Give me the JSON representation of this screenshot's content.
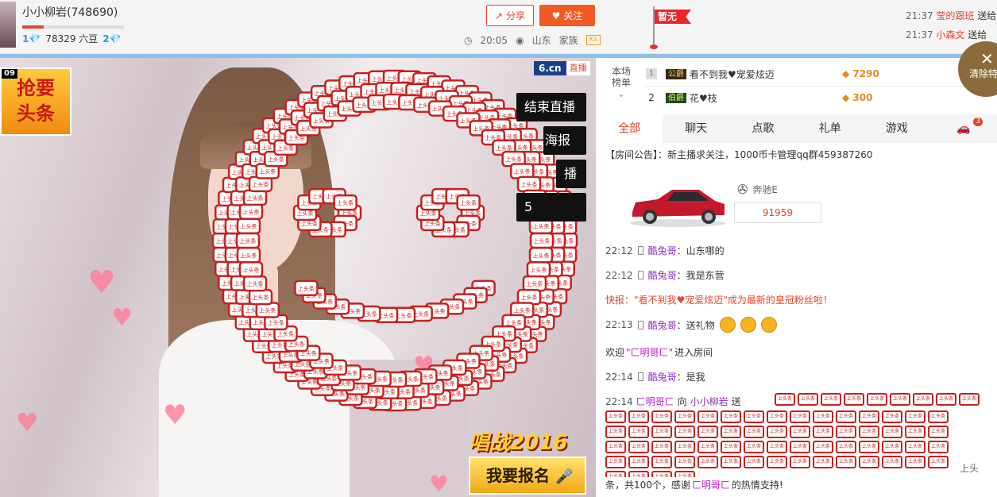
{
  "host": {
    "name": "小小柳岩",
    "room_id": "(748690)",
    "level_left": "1",
    "beans": "78329 六豆",
    "level_right": "2",
    "level_progress": 0.21
  },
  "actions": {
    "share": "分享",
    "follow": "关注"
  },
  "meta": {
    "time": "20:05",
    "location": "山东",
    "family_label": "家族",
    "family_tag": "Ks"
  },
  "flag": {
    "label": "暂无"
  },
  "feed": [
    {
      "time": "21:37",
      "name": "莹的跟班",
      "action": "送给"
    },
    {
      "time": "21:37",
      "name": "小森文",
      "action": "送给"
    }
  ],
  "clear_button": {
    "label": "清除特"
  },
  "video": {
    "site": "6.cn",
    "live": "直播",
    "buttons": [
      "结束直播",
      "海报",
      "播",
      "5"
    ],
    "promo_left": {
      "counter": "09",
      "line1": "抢要",
      "line2": "头条"
    },
    "promo_right_title": "唱战2016",
    "promo_right_button": "我要报名",
    "tag_text": "上头条"
  },
  "rank": {
    "label_line1": "本场",
    "label_line2": "榜单",
    "rows": [
      {
        "num": "1",
        "noble": "公爵",
        "name": "看不到我♥宠爱炫迈",
        "coins": "7290"
      },
      {
        "num": "2",
        "noble": "伯爵",
        "name": "花♥枝",
        "coins": "300"
      }
    ]
  },
  "tabs": [
    "全部",
    "聊天",
    "点歌",
    "礼单",
    "游戏"
  ],
  "tab_badge": "3",
  "notice": "【房间公告】：新主播求关注，1000币卡管理qq群459387260",
  "car": {
    "brand": "奔驰E",
    "number": "91959"
  },
  "chat": [
    {
      "time": "22:12",
      "user": "酷兔哥",
      "text": "：山东哪的"
    },
    {
      "time": "22:12",
      "user": "酷兔哥",
      "text": "：我是东营"
    }
  ],
  "flash": {
    "prefix": "快报：\"看不到我",
    "name": "宠爱炫迈",
    "suffix": "\"成为最新的皇冠粉丝啦！"
  },
  "gift_msg": {
    "time": "22:13",
    "user": "酷兔哥",
    "text": "：送礼物"
  },
  "welcome": {
    "prefix": "欢迎",
    "user": "\"ㄈ明哥ㄈ\"",
    "suffix": "进入房间"
  },
  "chat2": {
    "time": "22:14",
    "user": "酷兔哥",
    "text": "：是我"
  },
  "big_gift": {
    "time": "22:14",
    "from": "ㄈ明哥ㄈ",
    "to_word": "向",
    "to": "小小柳岩",
    "send": "送",
    "tail": "上头",
    "line2_a": "条，共100个，感谢",
    "line2_user": "ㄈ明哥ㄈ",
    "line2_b": "的热情支持!"
  },
  "colors": {
    "accent": "#e8442a",
    "follow": "#f15a22",
    "blue_line": "#8ec1e8",
    "user": "#8e2bc1"
  }
}
